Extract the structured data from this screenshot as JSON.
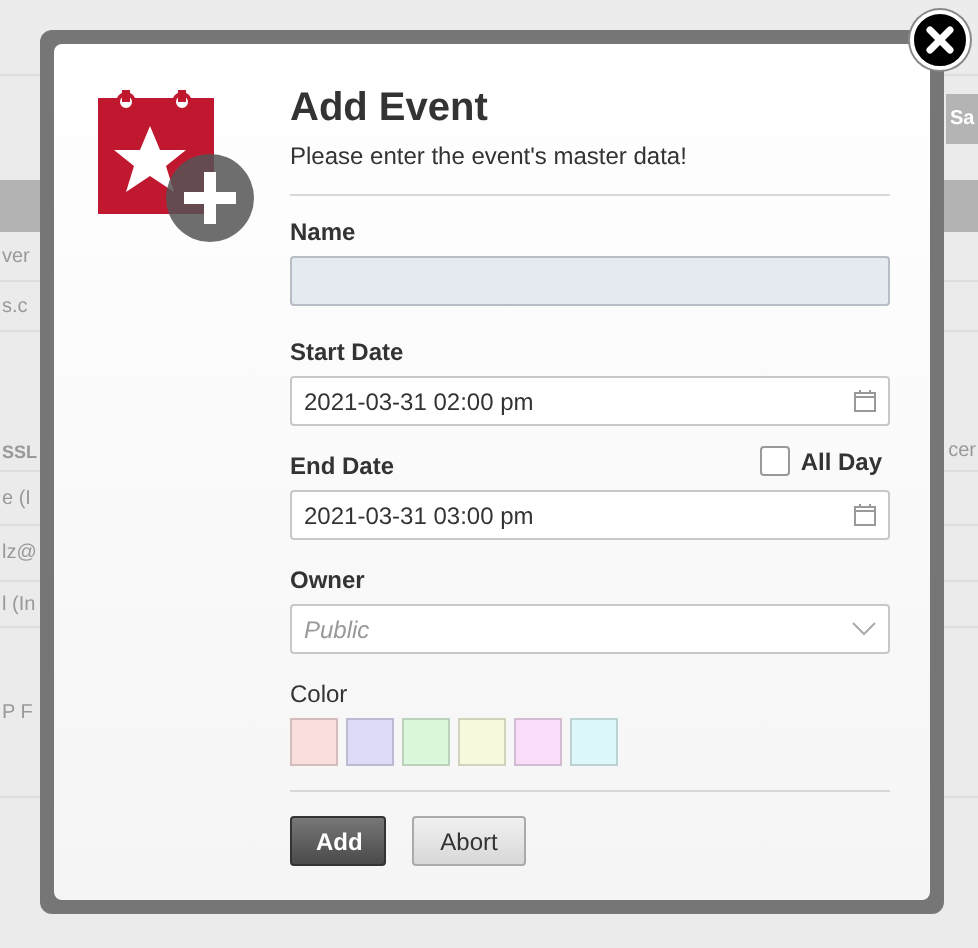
{
  "background_page": {
    "save_button": "Sa",
    "rows": [
      {
        "left": "ver"
      },
      {
        "left": "s.c"
      },
      {
        "left": "SSL",
        "right": "cer",
        "kind": "heading"
      },
      {
        "left": "e (I"
      },
      {
        "left": "lz@"
      },
      {
        "left": "l (In"
      },
      {
        "left": "P F"
      }
    ]
  },
  "dialog": {
    "title": "Add Event",
    "subtitle": "Please enter the event's master data!",
    "name": {
      "label": "Name"
    },
    "start_date": {
      "label": "Start Date",
      "value": "2021-03-31 02:00 pm"
    },
    "end_date": {
      "label": "End Date",
      "value": "2021-03-31 03:00 pm"
    },
    "all_day": {
      "label": "All Day",
      "checked": false
    },
    "owner": {
      "label": "Owner",
      "placeholder": "Public"
    },
    "color": {
      "label": "Color",
      "swatches": [
        {
          "color": "#fadddd",
          "selected": false
        },
        {
          "color": "#dcdcf8",
          "selected": false
        },
        {
          "color": "#dcf8dc",
          "selected": false
        },
        {
          "color": "#f8f8dc",
          "selected": false
        },
        {
          "color": "#f8dcf8",
          "selected": false
        },
        {
          "color": "#dcf8f8",
          "selected": false
        }
      ]
    },
    "buttons": [
      {
        "label": "Add",
        "kind": "primary"
      },
      {
        "label": "Abort",
        "kind": "secondary"
      }
    ]
  }
}
